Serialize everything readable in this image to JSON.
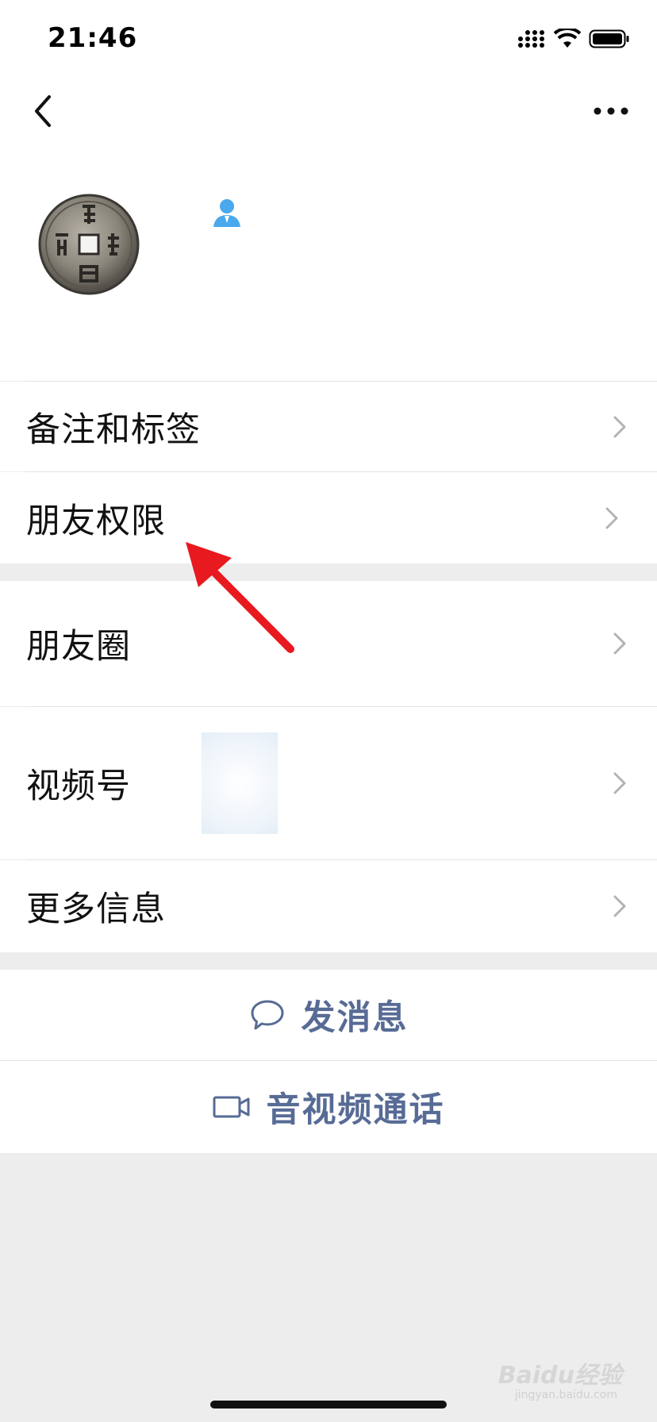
{
  "status_bar": {
    "time": "21:46"
  },
  "menu": {
    "remark_tags": "备注和标签",
    "friend_permissions": "朋友权限",
    "moments": "朋友圈",
    "channels": "视频号",
    "more_info": "更多信息"
  },
  "actions": {
    "send_message": "发消息",
    "voice_video_call": "音视频通话"
  },
  "watermark": {
    "brand": "Baidu经验",
    "url": "jingyan.baidu.com"
  },
  "colors": {
    "link": "#576b95",
    "annotation_arrow": "#e8191f",
    "gender_icon": "#4aa8ec"
  }
}
